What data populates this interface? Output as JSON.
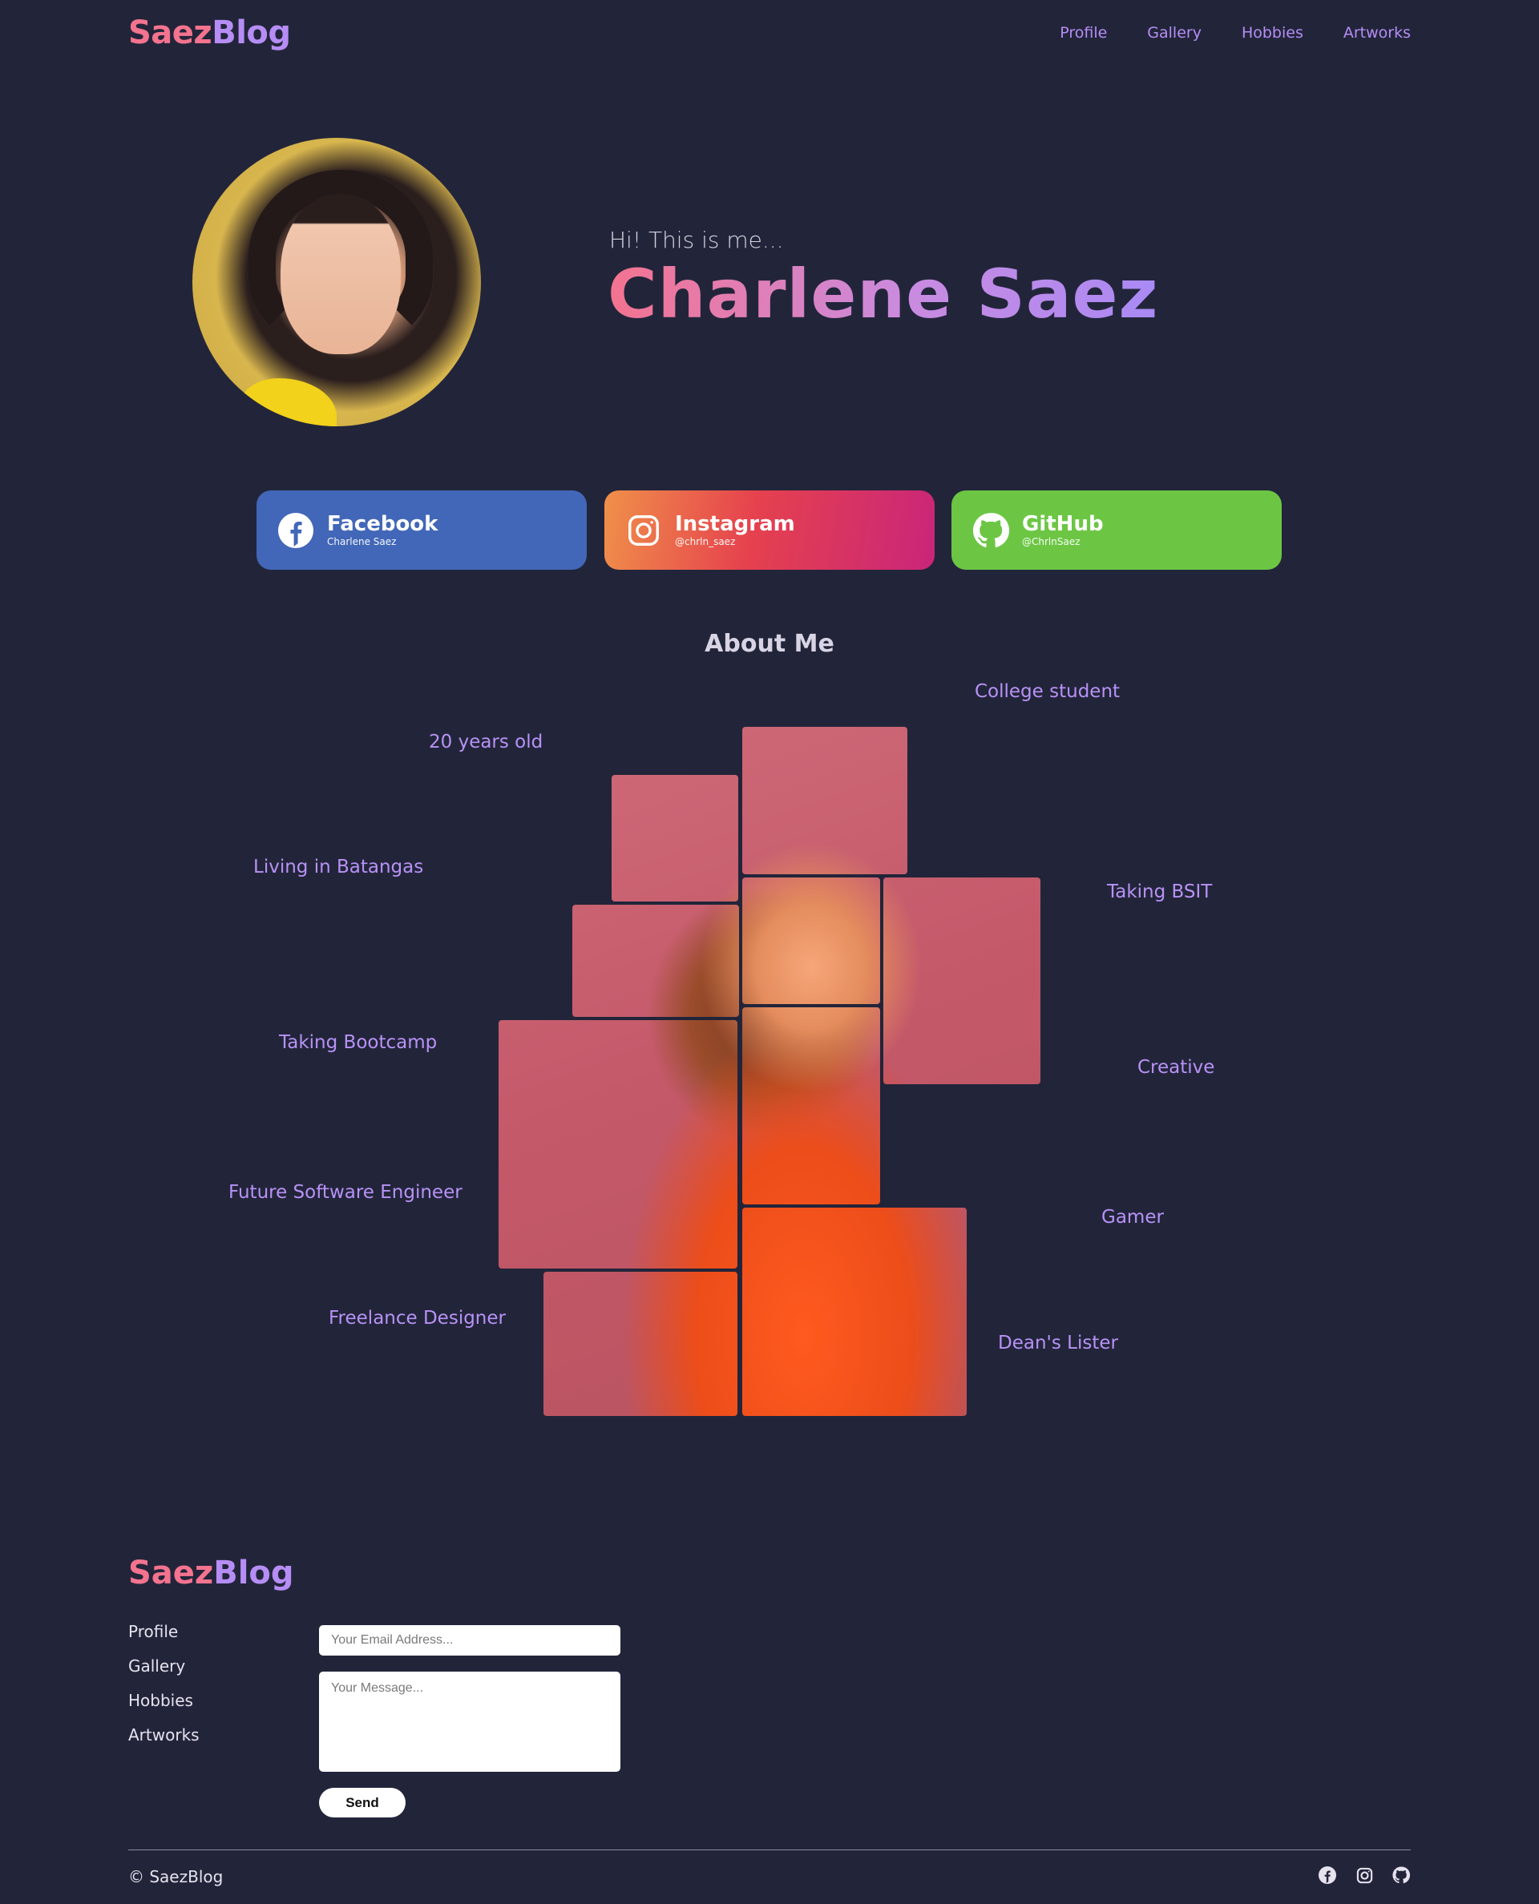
{
  "header": {
    "brand_part1": "Saez",
    "brand_part2": "Blog",
    "nav": [
      "Profile",
      "Gallery",
      "Hobbies",
      "Artworks"
    ]
  },
  "hero": {
    "greeting": "Hi! This is me...",
    "name": "Charlene Saez"
  },
  "social": [
    {
      "title": "Facebook",
      "handle": "Charlene Saez",
      "icon": "facebook-icon",
      "color": "#4267b8"
    },
    {
      "title": "Instagram",
      "handle": "@chrln_saez",
      "icon": "instagram-icon",
      "color": "#e5414e"
    },
    {
      "title": "GitHub",
      "handle": "@ChrlnSaez",
      "icon": "github-icon",
      "color": "#6cc644"
    }
  ],
  "about": {
    "title": "About Me",
    "facts": [
      "College student",
      "20 years old",
      "Living in Batangas",
      "Taking BSIT",
      "Taking Bootcamp",
      "Creative",
      "Future Software Engineer",
      "Gamer",
      "Freelance Designer",
      "Dean's Lister"
    ]
  },
  "footer": {
    "brand_part1": "Saez",
    "brand_part2": "Blog",
    "links": [
      "Profile",
      "Gallery",
      "Hobbies",
      "Artworks"
    ],
    "email_placeholder": "Your Email Address...",
    "message_placeholder": "Your Message...",
    "send_label": "Send",
    "copyright": "© SaezBlog",
    "icons": [
      "facebook-icon",
      "instagram-icon",
      "github-icon"
    ]
  },
  "colors": {
    "background": "#22253a",
    "accent_pink": "#f4738f",
    "accent_purple": "#b68df5"
  }
}
